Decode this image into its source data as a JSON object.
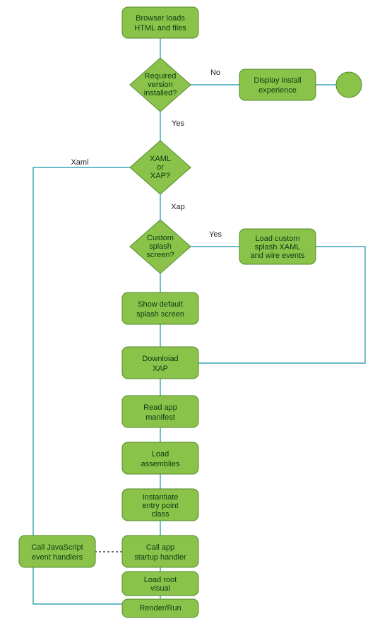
{
  "chart_data": {
    "type": "flowchart",
    "title": "",
    "nodes": [
      {
        "id": "n1",
        "type": "process",
        "text": "Browser loads\nHTML and files"
      },
      {
        "id": "d1",
        "type": "decision",
        "text": "Required\nversion\ninstalled?"
      },
      {
        "id": "n2",
        "type": "process",
        "text": "Display install\nexperience"
      },
      {
        "id": "end",
        "type": "terminator",
        "text": ""
      },
      {
        "id": "d2",
        "type": "decision",
        "text": "XAML\nor\nXAP?"
      },
      {
        "id": "d3",
        "type": "decision",
        "text": "Custom\nsplash\nscreen?"
      },
      {
        "id": "n3",
        "type": "process",
        "text": "Load custom\nsplash XAML\nand wire events"
      },
      {
        "id": "n4",
        "type": "process",
        "text": "Show default\nsplash screen"
      },
      {
        "id": "n5",
        "type": "process",
        "text": "Downloiad\nXAP"
      },
      {
        "id": "n6",
        "type": "process",
        "text": "Read app\nmanifest"
      },
      {
        "id": "n7",
        "type": "process",
        "text": "Load\nassemblies"
      },
      {
        "id": "n8",
        "type": "process",
        "text": "Instantiate\nentry point\nclass"
      },
      {
        "id": "n9",
        "type": "process",
        "text": "Call app\nstartup handler"
      },
      {
        "id": "n10",
        "type": "process",
        "text": "Load root\nvisual"
      },
      {
        "id": "n11",
        "type": "process",
        "text": "Render/Run"
      },
      {
        "id": "n12",
        "type": "process",
        "text": "Call JavaScript\nevent handlers"
      }
    ],
    "edges": [
      {
        "from": "n1",
        "to": "d1",
        "label": ""
      },
      {
        "from": "d1",
        "to": "n2",
        "label": "No"
      },
      {
        "from": "n2",
        "to": "end",
        "label": ""
      },
      {
        "from": "d1",
        "to": "d2",
        "label": "Yes"
      },
      {
        "from": "d2",
        "to": "n11",
        "label": "Xaml",
        "route": "left-long"
      },
      {
        "from": "d2",
        "to": "d3",
        "label": "Xap"
      },
      {
        "from": "d3",
        "to": "n3",
        "label": "Yes"
      },
      {
        "from": "n3",
        "to": "n5",
        "label": "",
        "route": "right-long"
      },
      {
        "from": "d3",
        "to": "n4",
        "label": ""
      },
      {
        "from": "n4",
        "to": "n5",
        "label": ""
      },
      {
        "from": "n5",
        "to": "n6",
        "label": ""
      },
      {
        "from": "n6",
        "to": "n7",
        "label": ""
      },
      {
        "from": "n7",
        "to": "n8",
        "label": ""
      },
      {
        "from": "n8",
        "to": "n9",
        "label": ""
      },
      {
        "from": "n9",
        "to": "n12",
        "label": "",
        "style": "dashed"
      },
      {
        "from": "n9",
        "to": "n10",
        "label": ""
      },
      {
        "from": "n10",
        "to": "n11",
        "label": ""
      }
    ]
  }
}
